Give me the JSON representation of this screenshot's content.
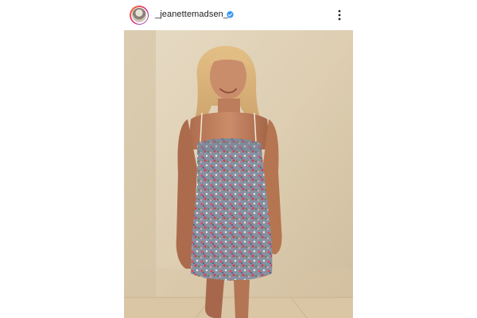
{
  "post": {
    "username": "_jeanettemadsen_",
    "verified": true,
    "icons": {
      "avatar": "profile-avatar",
      "verified": "verified-badge-icon",
      "more": "more-options-icon"
    },
    "image": {
      "subject": "photo"
    }
  },
  "colors": {
    "verified_blue": "#3897f0",
    "wall": "#ddd0b6",
    "floor": "#d9c7a7"
  }
}
